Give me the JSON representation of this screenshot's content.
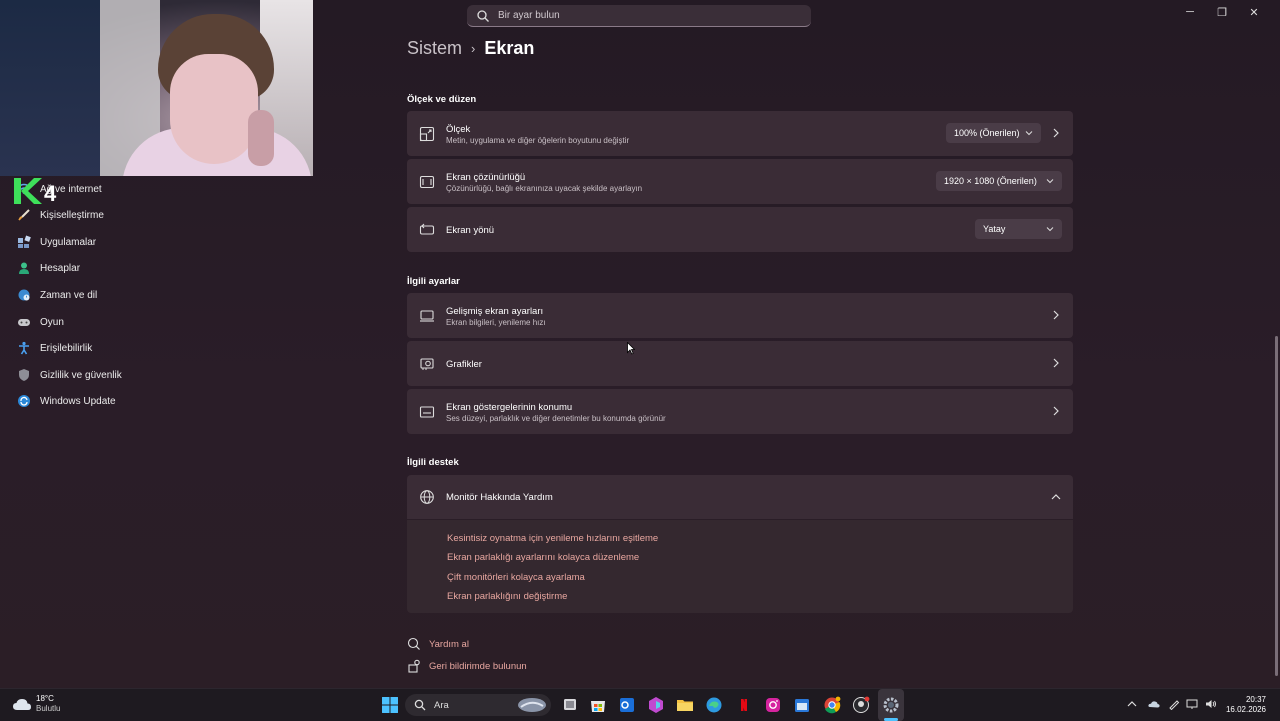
{
  "window": {
    "minimize_icon": "─",
    "maximize_icon": "❐",
    "close_icon": "✕"
  },
  "search": {
    "placeholder": "Bir ayar bulun"
  },
  "breadcrumb": {
    "parent": "Sistem",
    "separator": "›",
    "current": "Ekran"
  },
  "overlay": {
    "logo_text": "4"
  },
  "sidebar": {
    "items": [
      {
        "label": "Ağ ve internet",
        "icon": "wifi-icon"
      },
      {
        "label": "Kişiselleştirme",
        "icon": "brush-icon"
      },
      {
        "label": "Uygulamalar",
        "icon": "apps-icon"
      },
      {
        "label": "Hesaplar",
        "icon": "person-icon"
      },
      {
        "label": "Zaman ve dil",
        "icon": "globe-clock-icon"
      },
      {
        "label": "Oyun",
        "icon": "gamepad-icon"
      },
      {
        "label": "Erişilebilirlik",
        "icon": "accessibility-icon"
      },
      {
        "label": "Gizlilik ve güvenlik",
        "icon": "shield-icon"
      },
      {
        "label": "Windows Update",
        "icon": "update-icon"
      }
    ]
  },
  "sections": {
    "scale_layout": "Ölçek ve düzen",
    "related_settings": "İlgili ayarlar",
    "related_support": "İlgili destek"
  },
  "scale": {
    "title": "Ölçek",
    "subtitle": "Metin, uygulama ve diğer öğelerin boyutunu değiştir",
    "value": "100% (Önerilen)"
  },
  "resolution": {
    "title": "Ekran çözünürlüğü",
    "subtitle": "Çözünürlüğü, bağlı ekranınıza uyacak şekilde ayarlayın",
    "value": "1920 × 1080 (Önerilen)"
  },
  "orientation": {
    "title": "Ekran yönü",
    "value": "Yatay"
  },
  "advanced": {
    "title": "Gelişmiş ekran ayarları",
    "subtitle": "Ekran bilgileri, yenileme hızı"
  },
  "graphics": {
    "title": "Grafikler"
  },
  "indicators": {
    "title": "Ekran göstergelerinin konumu",
    "subtitle": "Ses düzeyi, parlaklık ve diğer denetimler bu konumda görünür"
  },
  "support": {
    "title": "Monitör Hakkında Yardım",
    "links": [
      "Kesintisiz oynatma için yenileme hızlarını eşitleme",
      "Ekran parlaklığı ayarlarını kolayca düzenleme",
      "Çift monitörleri kolayca ayarlama",
      "Ekran parlaklığını değiştirme"
    ]
  },
  "footer": {
    "help": "Yardım al",
    "feedback": "Geri bildirimde bulunun"
  },
  "taskbar": {
    "weather_temp": "18°C",
    "weather_desc": "Bulutlu",
    "search_label": "Ara",
    "time": "20:37",
    "date": "16.02.2026"
  },
  "colors": {
    "accent_link": "#e8a7a0",
    "card": "#3a2c36",
    "background": "#241a24"
  }
}
